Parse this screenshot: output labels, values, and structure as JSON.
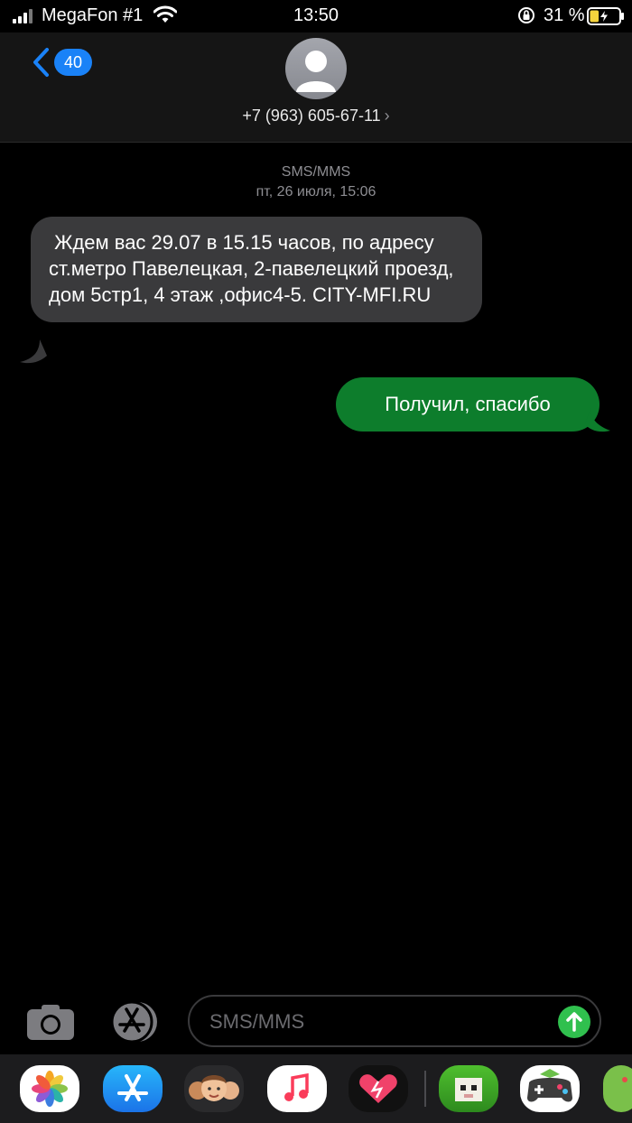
{
  "status_bar": {
    "carrier": "MegaFon #1",
    "time": "13:50",
    "battery_percent": "31 %",
    "battery_level": 0.31,
    "icons": [
      "signal-icon",
      "wifi-icon",
      "orientation-lock-icon",
      "battery-charging-icon"
    ]
  },
  "header": {
    "back_count": "40",
    "contact": "+7 (963) 605-67-11",
    "contact_chevron": "›"
  },
  "thread": {
    "service": "SMS/MMS",
    "date": "пт, 26 июля, 15:06",
    "messages": [
      {
        "direction": "incoming",
        "text": " Ждем вас 29.07 в 15.15 часов, по адресу ст.метро Павелецкая, 2-павелецкий проезд, дом 5стр1, 4 этаж ,офис4-5. CITY-MFI.RU"
      },
      {
        "direction": "outgoing",
        "text": "Получил, спасибо"
      }
    ]
  },
  "composer": {
    "placeholder": "SMS/MMS",
    "icons": [
      "camera-icon",
      "app-store-icon",
      "send-arrow-icon"
    ]
  },
  "app_drawer": {
    "apps": [
      "photos-app-icon",
      "app-store-app-icon",
      "memoji-app-icon",
      "music-app-icon",
      "digital-touch-app-icon",
      "game-app-icon",
      "game-controller-app-icon",
      "green-app-icon"
    ]
  },
  "colors": {
    "incoming_bubble": "#3a3a3c",
    "outgoing_bubble": "#0d7d2c",
    "accent_blue": "#1a82f7",
    "send_green": "#30c04e"
  }
}
